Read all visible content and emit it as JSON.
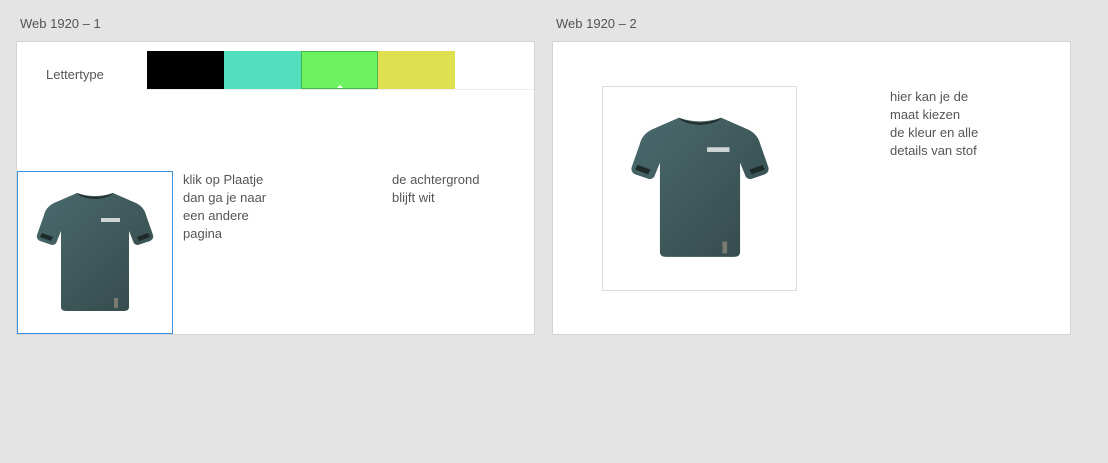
{
  "artboards": [
    {
      "label": "Web 1920 – 1",
      "font_label": "Lettertype",
      "swatches": [
        {
          "color": "#000000"
        },
        {
          "color": "#51dfbd"
        },
        {
          "color": "#6cf35f",
          "selected": true
        },
        {
          "color": "#dfe04f"
        }
      ],
      "note_click": "klik op Plaatje\ndan ga je naar\neen andere\npagina",
      "note_background": "de achtergrond\nblijft wit",
      "product_image_icon": "tshirt-icon",
      "shirt_color": "#3f5b5e"
    },
    {
      "label": "Web 1920 – 2",
      "note_details": "hier kan je de\nmaat kiezen\nde kleur en alle\ndetails van stof",
      "product_image_icon": "tshirt-icon",
      "shirt_color": "#3f5b5e"
    }
  ],
  "background_color": "#e4e4e4"
}
